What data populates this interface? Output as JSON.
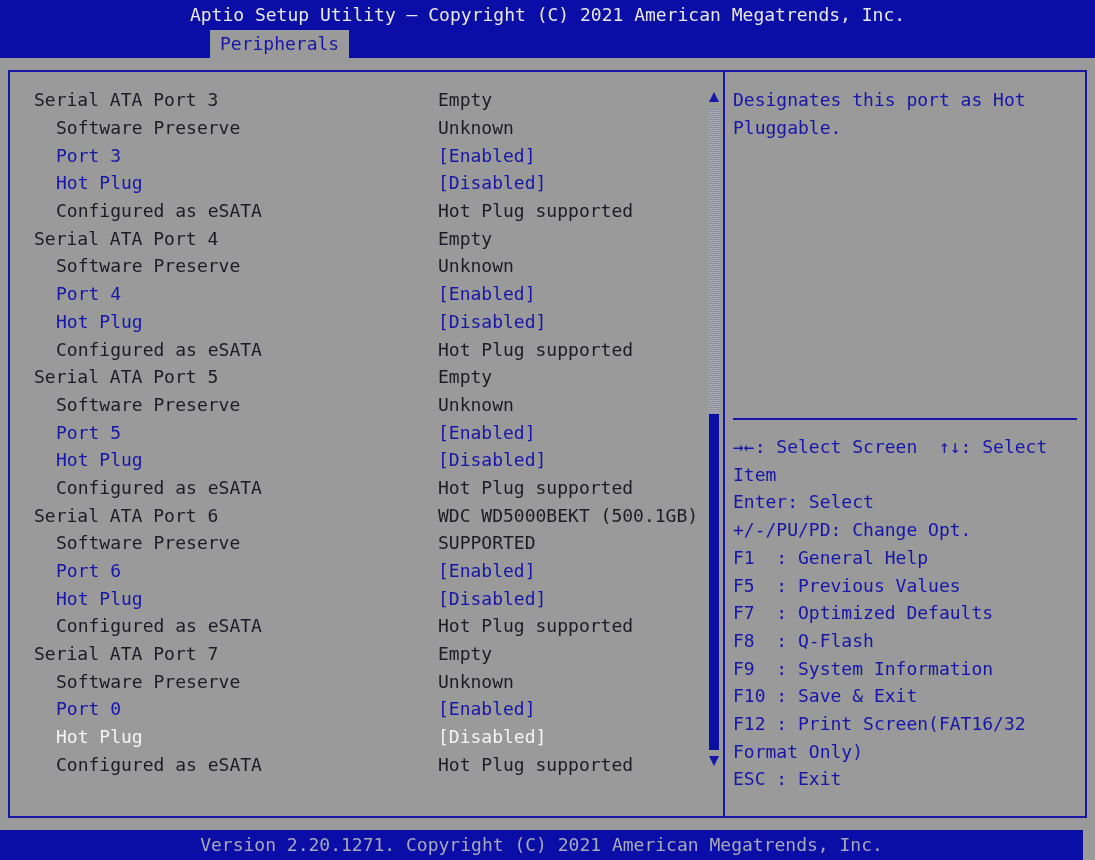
{
  "header": {
    "title": "Aptio Setup Utility – Copyright (C) 2021 American Megatrends, Inc."
  },
  "tabs": [
    {
      "label": "Peripherals",
      "selected": true
    }
  ],
  "rows": [
    {
      "kind": "group",
      "label": "Serial ATA Port 3",
      "value": "Empty",
      "selected": false
    },
    {
      "kind": "info",
      "label": "Software Preserve",
      "value": "Unknown",
      "selected": false
    },
    {
      "kind": "option",
      "label": "Port 3",
      "value": "[Enabled]",
      "selected": false
    },
    {
      "kind": "option",
      "label": "Hot Plug",
      "value": "[Disabled]",
      "selected": false
    },
    {
      "kind": "info",
      "label": "Configured as eSATA",
      "value": "Hot Plug supported",
      "selected": false
    },
    {
      "kind": "group",
      "label": "Serial ATA Port 4",
      "value": "Empty",
      "selected": false
    },
    {
      "kind": "info",
      "label": "Software Preserve",
      "value": "Unknown",
      "selected": false
    },
    {
      "kind": "option",
      "label": "Port 4",
      "value": "[Enabled]",
      "selected": false
    },
    {
      "kind": "option",
      "label": "Hot Plug",
      "value": "[Disabled]",
      "selected": false
    },
    {
      "kind": "info",
      "label": "Configured as eSATA",
      "value": "Hot Plug supported",
      "selected": false
    },
    {
      "kind": "group",
      "label": "Serial ATA Port 5",
      "value": "Empty",
      "selected": false
    },
    {
      "kind": "info",
      "label": "Software Preserve",
      "value": "Unknown",
      "selected": false
    },
    {
      "kind": "option",
      "label": "Port 5",
      "value": "[Enabled]",
      "selected": false
    },
    {
      "kind": "option",
      "label": "Hot Plug",
      "value": "[Disabled]",
      "selected": false
    },
    {
      "kind": "info",
      "label": "Configured as eSATA",
      "value": "Hot Plug supported",
      "selected": false
    },
    {
      "kind": "group",
      "label": "Serial ATA Port 6",
      "value": "WDC WD5000BEKT (500.1GB)",
      "selected": false
    },
    {
      "kind": "info",
      "label": "Software Preserve",
      "value": "SUPPORTED",
      "selected": false
    },
    {
      "kind": "option",
      "label": "Port 6",
      "value": "[Enabled]",
      "selected": false
    },
    {
      "kind": "option",
      "label": "Hot Plug",
      "value": "[Disabled]",
      "selected": false
    },
    {
      "kind": "info",
      "label": "Configured as eSATA",
      "value": "Hot Plug supported",
      "selected": false
    },
    {
      "kind": "group",
      "label": "Serial ATA Port 7",
      "value": "Empty",
      "selected": false
    },
    {
      "kind": "info",
      "label": "Software Preserve",
      "value": "Unknown",
      "selected": false
    },
    {
      "kind": "option",
      "label": "Port 0",
      "value": "[Enabled]",
      "selected": false
    },
    {
      "kind": "option",
      "label": "Hot Plug",
      "value": "[Disabled]",
      "selected": true
    },
    {
      "kind": "info",
      "label": "Configured as eSATA",
      "value": "Hot Plug supported",
      "selected": false
    }
  ],
  "help": {
    "description": "Designates this port as Hot Pluggable.",
    "keys": [
      "→←: Select Screen  ↑↓: Select Item",
      "Enter: Select",
      "+/-/PU/PD: Change Opt.",
      "F1  : General Help",
      "F5  : Previous Values",
      "F7  : Optimized Defaults",
      "F8  : Q-Flash",
      "F9  : System Information",
      "F10 : Save & Exit",
      "F12 : Print Screen(FAT16/32 Format Only)",
      "ESC : Exit"
    ]
  },
  "footer": {
    "text": "Version 2.20.1271. Copyright (C) 2021 American Megatrends, Inc."
  }
}
